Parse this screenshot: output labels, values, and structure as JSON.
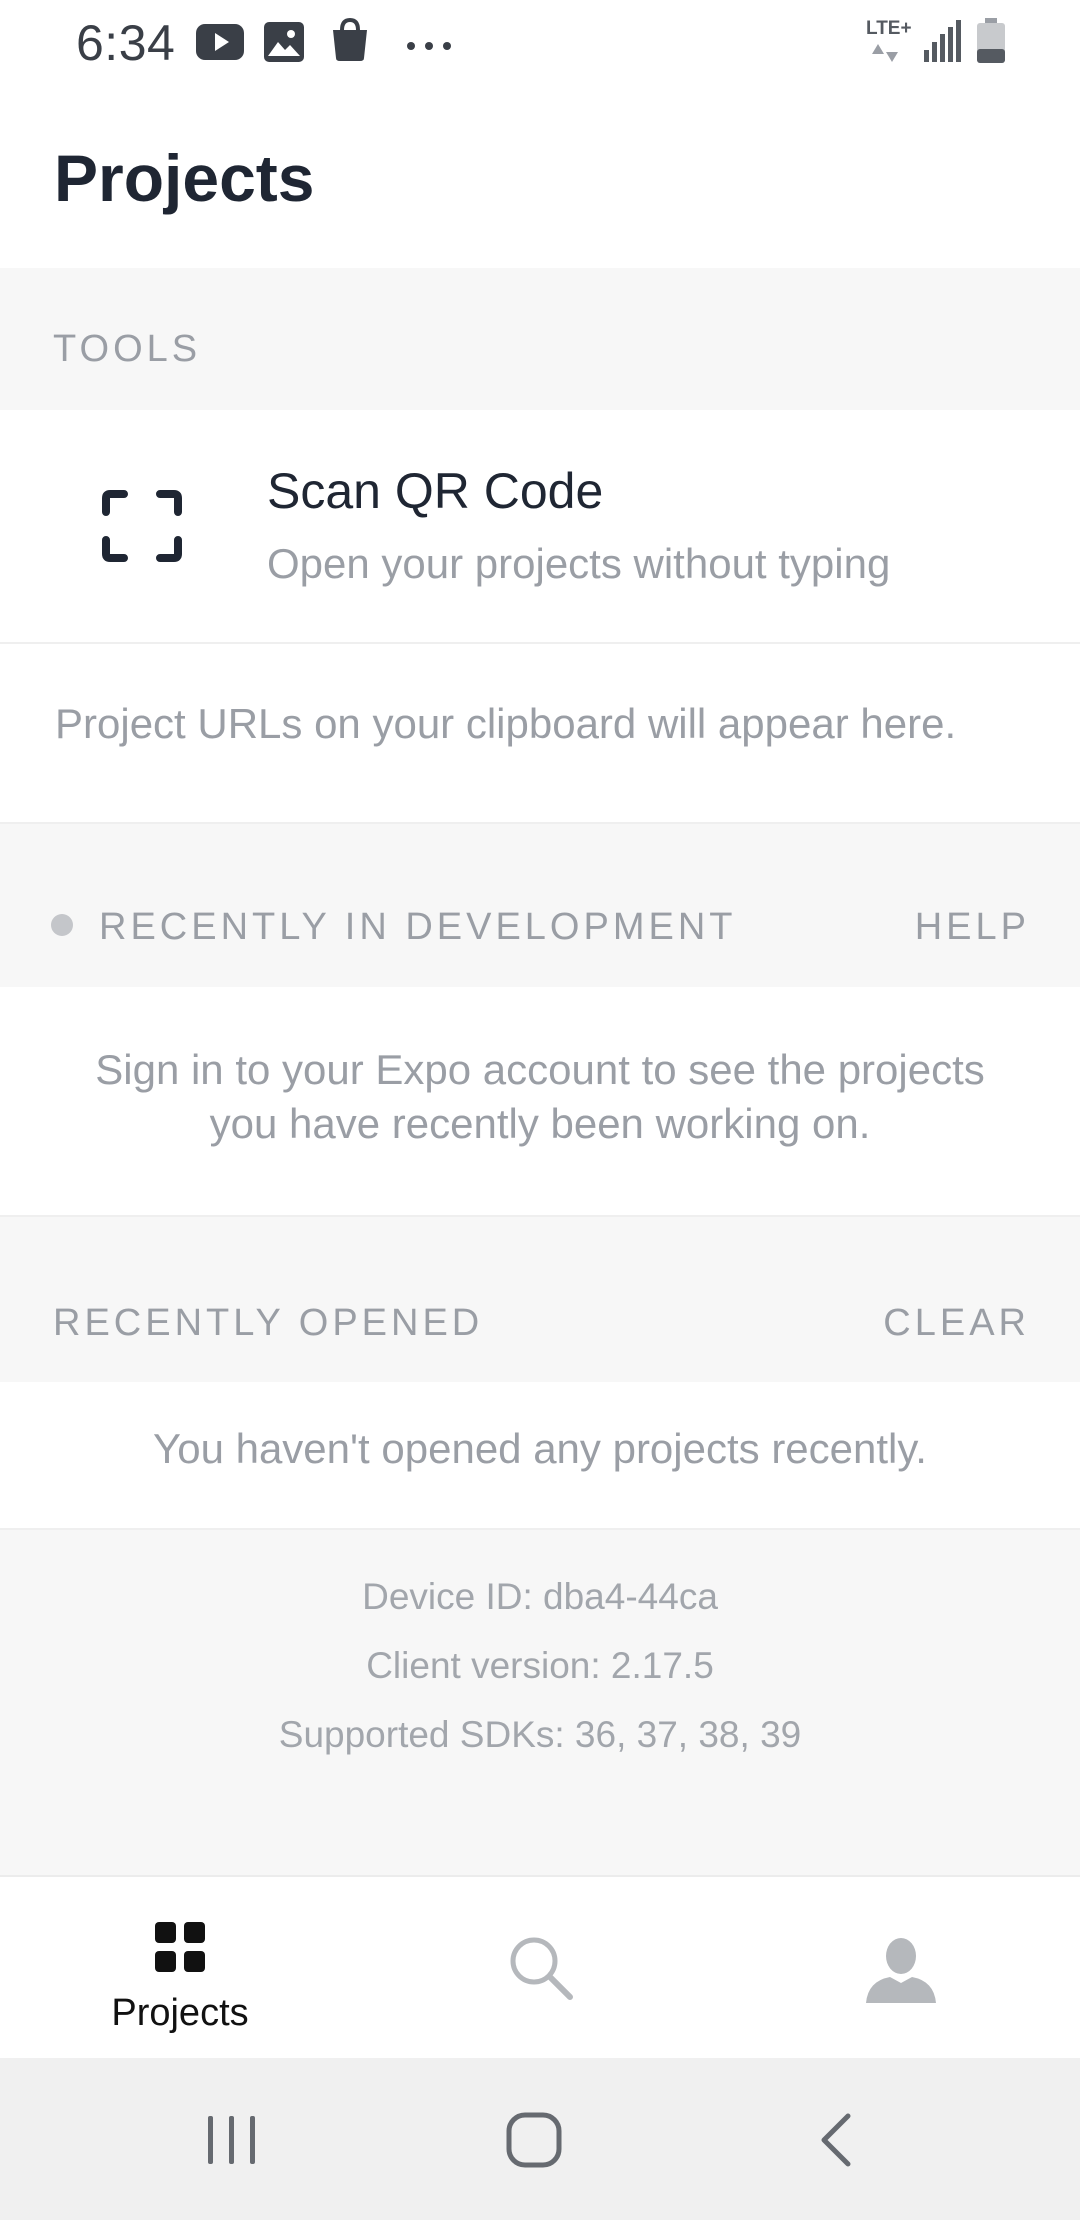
{
  "status_bar": {
    "time": "6:34",
    "icons": [
      "youtube-icon",
      "image-icon",
      "shopping-bag-icon",
      "more-dots-icon",
      "lte-plus-icon",
      "signal-icon",
      "battery-icon"
    ],
    "network_label": "LTE+"
  },
  "header": {
    "title": "Projects"
  },
  "tools": {
    "section_label": "TOOLS",
    "scan": {
      "icon": "qr-scan-icon",
      "title": "Scan QR Code",
      "subtitle": "Open your projects without typing"
    },
    "clipboard_message": "Project URLs on your clipboard will appear here."
  },
  "recently_in_development": {
    "section_label": "RECENTLY IN DEVELOPMENT",
    "action_label": "HELP",
    "message_line1": "Sign in to your Expo account to see the projects",
    "message_line2": "you have recently been working on."
  },
  "recently_opened": {
    "section_label": "RECENTLY OPENED",
    "action_label": "CLEAR",
    "message": "You haven't opened any projects recently."
  },
  "info": {
    "device_id": "Device ID: dba4-44ca",
    "client_version": "Client version: 2.17.5",
    "supported_sdks": "Supported SDKs: 36, 37, 38, 39"
  },
  "tab_bar": {
    "tabs": [
      {
        "label": "Projects",
        "icon": "grid-icon",
        "active": true
      },
      {
        "label": "",
        "icon": "search-icon",
        "active": false
      },
      {
        "label": "",
        "icon": "profile-icon",
        "active": false
      }
    ]
  },
  "nav_bar": {
    "icons": [
      "recents-icon",
      "home-icon",
      "back-icon"
    ]
  },
  "colors": {
    "title_text": "#1f2633",
    "muted_text": "#9a9ea5",
    "section_background": "#f7f7f7",
    "nav_background": "#f0f0f0"
  }
}
